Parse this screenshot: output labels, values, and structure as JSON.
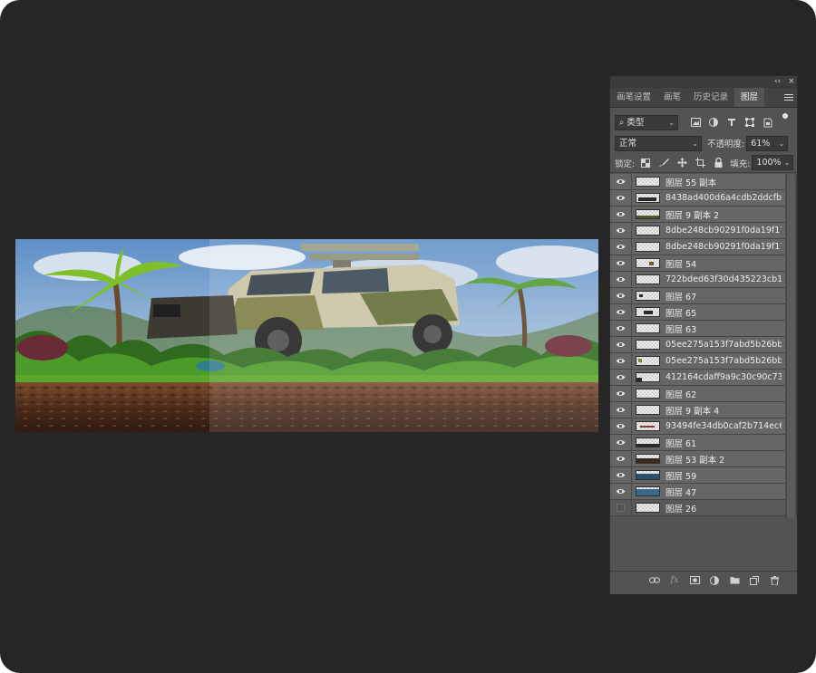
{
  "panel": {
    "collapse_label": "‹‹",
    "close_label": "×",
    "tabs": [
      {
        "label": "画笔设置",
        "active": false
      },
      {
        "label": "画笔",
        "active": false
      },
      {
        "label": "历史记录",
        "active": false
      },
      {
        "label": "图层",
        "active": true
      }
    ],
    "filter": {
      "kind_label": "类型",
      "search_glyph": "⌕"
    },
    "blend": {
      "mode": "正常",
      "opacity_label": "不透明度:",
      "opacity_value": "61%"
    },
    "lock": {
      "lock_label": "锁定:",
      "fill_label": "填充:",
      "fill_value": "100%"
    },
    "layers": [
      {
        "name": "图层 55 副本",
        "visible": true
      },
      {
        "name": "8438ad400d6a4cdb2ddcfb...",
        "visible": true
      },
      {
        "name": "图层 9 副本 2",
        "visible": true
      },
      {
        "name": "8dbe248cb90291f0da19f17...",
        "visible": true
      },
      {
        "name": "8dbe248cb90291f0da19f17...",
        "visible": true
      },
      {
        "name": "图层 54",
        "visible": true
      },
      {
        "name": "722bded63f30d435223cb1...",
        "visible": true
      },
      {
        "name": "图层 67",
        "visible": true
      },
      {
        "name": "图层 65",
        "visible": true
      },
      {
        "name": "图层 63",
        "visible": true
      },
      {
        "name": "05ee275a153f7abd5b26bb...",
        "visible": true
      },
      {
        "name": "05ee275a153f7abd5b26bb...",
        "visible": true
      },
      {
        "name": "412164cdaff9a9c30c90c73...",
        "visible": true
      },
      {
        "name": "图层 62",
        "visible": true
      },
      {
        "name": "图层 9 副本 4",
        "visible": true
      },
      {
        "name": "93494fe34db0caf2b714ec6...",
        "visible": true
      },
      {
        "name": "图层 61",
        "visible": true
      },
      {
        "name": "图层 53 副本 2",
        "visible": true
      },
      {
        "name": "图层 59",
        "visible": true
      },
      {
        "name": "图层 47",
        "visible": true
      },
      {
        "name": "图层 26",
        "visible": false
      }
    ],
    "bottom_fx_label": "fx"
  },
  "colors": {
    "app_bg": "#262626",
    "panel_bg": "#535353",
    "row_visible": "#666666",
    "sky": "#6f9dc9",
    "soil": "#5a3622",
    "grass": "#3e8a26"
  }
}
